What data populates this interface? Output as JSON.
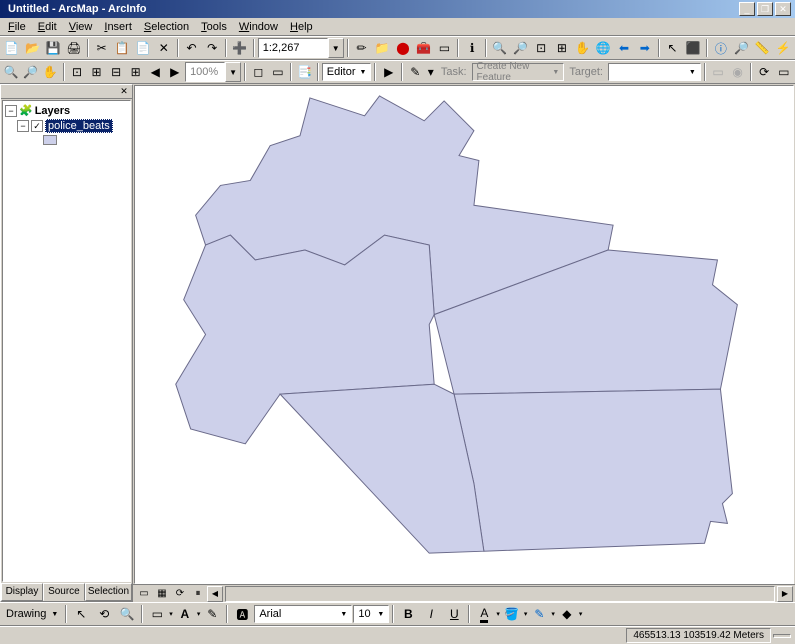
{
  "title": "Untitled - ArcMap - ArcInfo",
  "menu": {
    "file": "File",
    "edit": "Edit",
    "view": "View",
    "insert": "Insert",
    "selection": "Selection",
    "tools": "Tools",
    "window": "Window",
    "help": "Help"
  },
  "scale": "1:2,267",
  "editor": {
    "label": "Editor",
    "task_label": "Task:",
    "task_value": "Create New Feature",
    "target_label": "Target:"
  },
  "toc": {
    "root": "Layers",
    "layer": "police_beats",
    "tabs": {
      "display": "Display",
      "source": "Source",
      "selection": "Selection"
    }
  },
  "drawing": {
    "label": "Drawing",
    "font": "Arial",
    "size": "10"
  },
  "status": {
    "coords": "465513.13  103519.42 Meters"
  },
  "layout_pct": "100%"
}
